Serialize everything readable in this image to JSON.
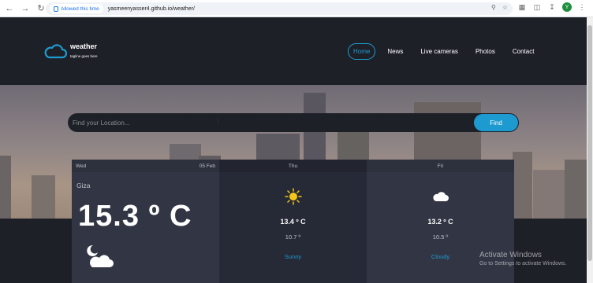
{
  "browser": {
    "site_chip": "Allowed this time",
    "url": "yasmeenyasser4.github.io/weather/",
    "profile_initial": "Y"
  },
  "header": {
    "logo_title": "weather",
    "logo_tagline": "tagline goes here",
    "menu": [
      {
        "label": "Home",
        "active": true
      },
      {
        "label": "News"
      },
      {
        "label": "Live cameras"
      },
      {
        "label": "Photos"
      },
      {
        "label": "Contact"
      }
    ]
  },
  "search": {
    "placeholder": "Find your Location...",
    "button": "Find"
  },
  "forecast": {
    "today": {
      "day": "Wed",
      "date": "05 Feb",
      "location": "Giza",
      "temp": "15.3 º C",
      "icon": "night-cloud-icon"
    },
    "days": [
      {
        "day": "Thu",
        "max": "13.4 º C",
        "min": "10.7 º",
        "condition": "Sunny",
        "icon": "sun-icon"
      },
      {
        "day": "Fri",
        "max": "13.2 º C",
        "min": "10.5 º",
        "condition": "Cloudy",
        "icon": "cloud-icon"
      }
    ]
  },
  "watermark": {
    "title": "Activate Windows",
    "subtitle": "Go to Settings to activate Windows."
  },
  "colors": {
    "accent": "#1d9bd0",
    "dark": "#1e2028",
    "card": "#323544"
  }
}
